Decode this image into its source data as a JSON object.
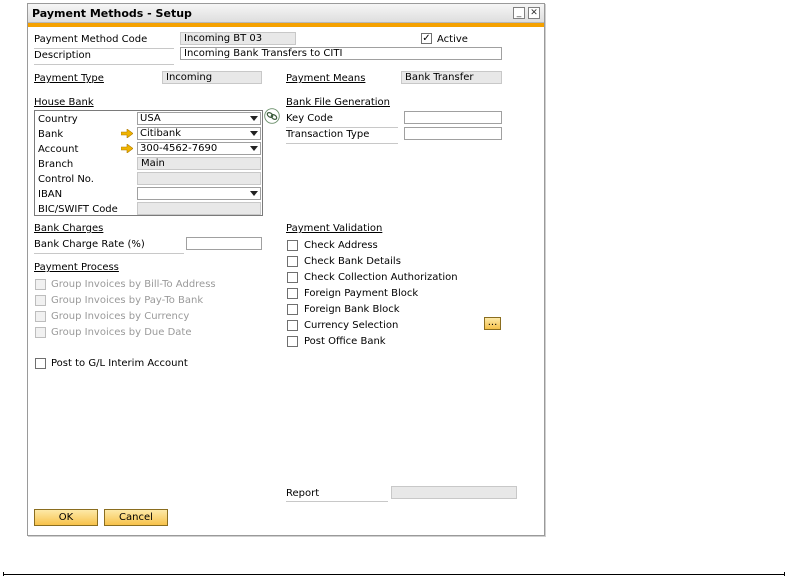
{
  "window": {
    "title": "Payment Methods - Setup",
    "minimize_icon": "minimize-icon",
    "close_icon": "close-icon"
  },
  "header": {
    "code_label": "Payment Method Code",
    "code_value": "Incoming BT 03",
    "active_label": "Active",
    "active_checked": true,
    "description_label": "Description",
    "description_value": "Incoming  Bank Transfers to CITI",
    "payment_type_label": "Payment Type",
    "payment_type_value": "Incoming",
    "payment_means_label": "Payment Means",
    "payment_means_value": "Bank Transfer"
  },
  "house_bank": {
    "title": "House Bank",
    "rows": [
      {
        "label": "Country",
        "value": "USA",
        "kind": "dropdown"
      },
      {
        "label": "Bank",
        "value": "Citibank",
        "kind": "dropdown",
        "arrow": true
      },
      {
        "label": "Account",
        "value": "300-4562-7690",
        "kind": "dropdown",
        "arrow": true
      },
      {
        "label": "Branch",
        "value": "Main",
        "kind": "readonly"
      },
      {
        "label": "Control No.",
        "value": "",
        "kind": "readonly"
      },
      {
        "label": "IBAN",
        "value": "",
        "kind": "dropdown"
      },
      {
        "label": "BIC/SWIFT Code",
        "value": "",
        "kind": "readonly"
      }
    ]
  },
  "bank_file": {
    "title": "Bank File Generation",
    "key_code_label": "Key Code",
    "key_code_value": "",
    "transaction_type_label": "Transaction Type",
    "transaction_type_value": ""
  },
  "bank_charges": {
    "title": "Bank Charges",
    "rate_label": "Bank Charge Rate (%)",
    "rate_value": ""
  },
  "payment_process": {
    "title": "Payment Process",
    "options": [
      "Group Invoices by Bill-To Address",
      "Group Invoices by Pay-To Bank",
      "Group Invoices by Currency",
      "Group Invoices by Due Date"
    ],
    "post_label": "Post to G/L Interim Account"
  },
  "payment_validation": {
    "title": "Payment Validation",
    "options": [
      "Check Address",
      "Check Bank Details",
      "Check Collection Authorization",
      "Foreign Payment Block",
      "Foreign Bank Block",
      "Currency Selection",
      "Post Office Bank"
    ],
    "more_button": "..."
  },
  "report": {
    "label": "Report",
    "value": ""
  },
  "buttons": {
    "ok": "OK",
    "cancel": "Cancel"
  }
}
